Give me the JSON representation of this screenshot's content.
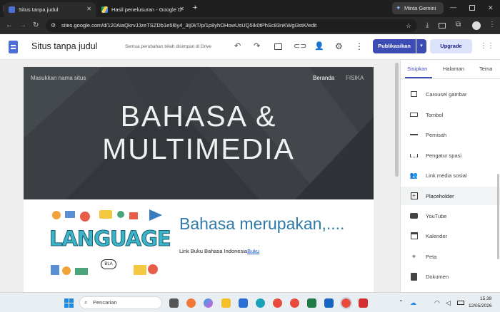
{
  "browser": {
    "tabs": [
      {
        "title": "Situs tanpa judul",
        "active": true
      },
      {
        "title": "Hasil penelusuran - Google Drive",
        "active": false
      }
    ],
    "new_tab": "+",
    "gemini_label": "Minta Gemini",
    "url": "sites.google.com/d/120AiaQkrvJJzeTSZDb1e5l6y4_3ij0kT/p/1p8yhOHowUsUQ5Ik0tPhSc83nKWgi3stK/edit"
  },
  "sites_header": {
    "doc_title": "Situs tanpa judul",
    "save_status": "Semua perubahan telah disimpan di Drive",
    "publish_label": "Publikasikan",
    "upgrade_label": "Upgrade"
  },
  "site": {
    "site_name_placeholder": "Masukkan nama situs",
    "nav": [
      "Beranda",
      "FISIKA"
    ],
    "hero_line1": "BAHASA &",
    "hero_line2": "MULTIMEDIA",
    "heading": "Bahasa merupakan,....",
    "link_prefix": "Link Buku Bahasa Indonesia",
    "link_text": "Buku",
    "image_word": "LANGUAGE",
    "image_bubble": "BLA"
  },
  "panel": {
    "tabs": [
      "Sisipkan",
      "Halaman",
      "Tema"
    ],
    "items": [
      {
        "label": "Carousel gambar",
        "icon": "carousel-icon"
      },
      {
        "label": "Tombol",
        "icon": "button-icon"
      },
      {
        "label": "Pemisah",
        "icon": "divider-icon"
      },
      {
        "label": "Pengatur spasi",
        "icon": "spacer-icon"
      },
      {
        "label": "Link media sosial",
        "icon": "people-icon"
      },
      {
        "label": "Placeholder",
        "icon": "placeholder-icon"
      },
      {
        "label": "YouTube",
        "icon": "youtube-icon"
      },
      {
        "label": "Kalender",
        "icon": "calendar-icon"
      },
      {
        "label": "Peta",
        "icon": "map-pin-icon"
      },
      {
        "label": "Dokumen",
        "icon": "document-icon"
      }
    ]
  },
  "taskbar": {
    "search_placeholder": "Pencarian",
    "time": "15.39",
    "date": "12/05/2026"
  },
  "colors": {
    "accent": "#3d4bb5",
    "upgrade_bg": "#dde3fb",
    "hero_bg": "#3b3f44",
    "heading": "#2f7aa8"
  }
}
